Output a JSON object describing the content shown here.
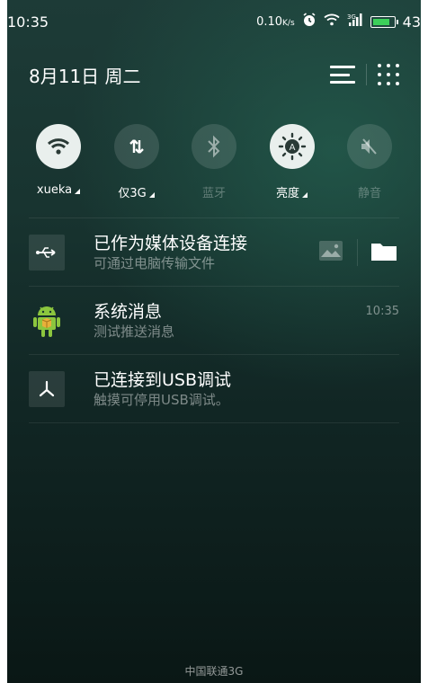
{
  "status_bar": {
    "time": "10:35",
    "network_speed": "0.10",
    "network_speed_unit": "K/s",
    "icons": [
      "alarm-icon",
      "wifi-icon",
      "signal-icon",
      "battery-icon"
    ],
    "battery_level": "43"
  },
  "header": {
    "date": "8月11日 周二",
    "icons": [
      "notification-list-icon",
      "app-grid-icon"
    ]
  },
  "quick_settings": [
    {
      "label": "xueka",
      "icon": "wifi-icon",
      "state": "on",
      "has_caret": true
    },
    {
      "label": "仅3G",
      "icon": "mobile-data-icon",
      "state": "off",
      "has_caret": true
    },
    {
      "label": "蓝牙",
      "icon": "bluetooth-icon",
      "state": "off",
      "has_caret": false
    },
    {
      "label": "亮度",
      "icon": "brightness-auto-icon",
      "state": "on",
      "has_caret": true
    },
    {
      "label": "静音",
      "icon": "mute-icon",
      "state": "off",
      "has_caret": false
    }
  ],
  "notifications": [
    {
      "title": "已作为媒体设备连接",
      "subtitle": "可通过电脑传输文件",
      "time": "",
      "icon": "usb-icon"
    },
    {
      "title": "系统消息",
      "subtitle": "测试推送消息",
      "time": "10:35",
      "icon": "android-icon"
    },
    {
      "title": "已连接到USB调试",
      "subtitle": "触摸可停用USB调试。",
      "time": "",
      "icon": "usb-debug-icon"
    }
  ],
  "carrier": "中国联通3G",
  "colors": {
    "battery_fill": "#3cd05a",
    "toggle_on": "#e9efed",
    "background_top": "#1d3b37",
    "background_bottom": "#0a1715"
  }
}
